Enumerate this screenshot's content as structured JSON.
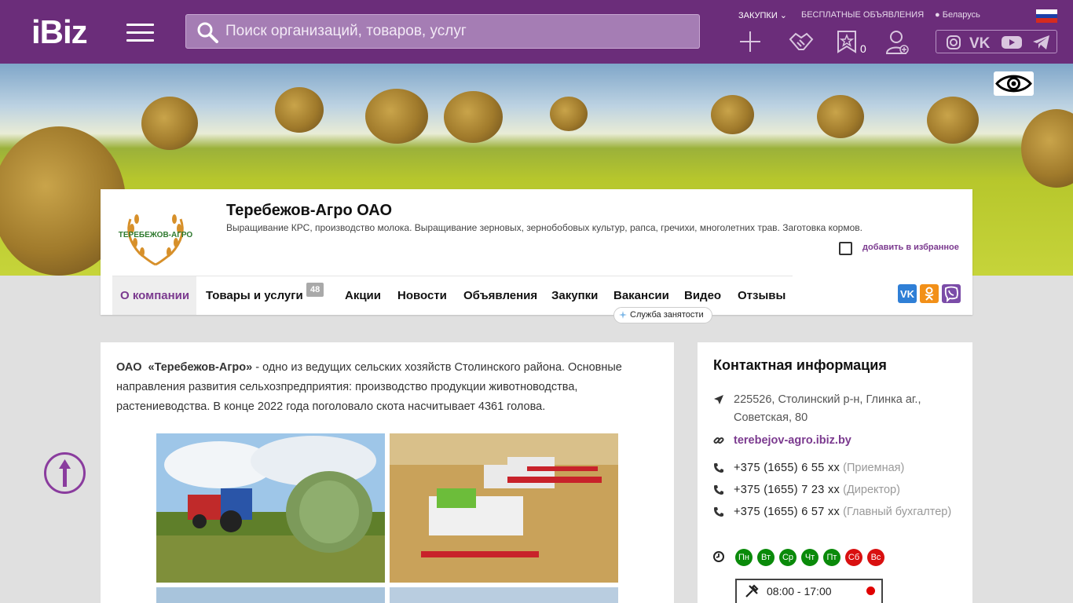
{
  "header": {
    "logo": "iBiz",
    "search_placeholder": "Поиск организаций, товаров, услуг",
    "links": [
      "ЗАКУПКИ",
      "БЕСПЛАТНЫЕ ОБЪЯВЛЕНИЯ",
      "Беларусь"
    ],
    "favorites_count": "0",
    "social": [
      "instagram-icon",
      "vk-icon",
      "youtube-icon",
      "telegram-icon"
    ]
  },
  "company": {
    "logo_text": "ТЕРЕБЕЖОВ-АГРО",
    "title": "Теребежов-Агро ОАО",
    "description": "Выращивание КРС, производство молока. Выращивание зерновых, зернобобовых культур, рапса, гречихи, многолетних трав. Заготовка кормов.",
    "favorite_label": "добавить в избранное"
  },
  "nav": {
    "tabs": [
      {
        "label": "О компании",
        "active": true
      },
      {
        "label": "Товары и услуги",
        "badge": "48"
      },
      {
        "label": "Акции"
      },
      {
        "label": "Новости"
      },
      {
        "label": "Объявления"
      },
      {
        "label": "Закупки"
      },
      {
        "label": "Вакансии"
      },
      {
        "label": "Видео"
      },
      {
        "label": "Отзывы"
      }
    ],
    "service_pill": "Служба занятости",
    "share": [
      "vk-share-icon",
      "ok-share-icon",
      "viber-share-icon"
    ]
  },
  "about": {
    "prefix": "ОАО",
    "name": "«Теребежов-Агро»",
    "text": " - одно из ведущих сельских хозяйств Столинского района. Основные направления развития сельхозпредприятия: производство продукции животноводства, растениеводства. В конце 2022 года поголовало скота насчитывает 4361 голова."
  },
  "contacts": {
    "title": "Контактная информация",
    "address": "225526, Столинский р-н, Глинка аг., Советская, 80",
    "site": "terebejov-agro.ibiz.by",
    "phones": [
      {
        "number": "+375 (1655) 6 55 xx",
        "note": "(Приемная)"
      },
      {
        "number": "+375 (1655) 7 23 xx",
        "note": "(Директор)"
      },
      {
        "number": "+375 (1655) 6 57 xx",
        "note": "(Главный бухгалтер)"
      }
    ],
    "days": [
      {
        "label": "Пн",
        "color": "#0a8a0a"
      },
      {
        "label": "Вт",
        "color": "#0a8a0a"
      },
      {
        "label": "Ср",
        "color": "#0a8a0a"
      },
      {
        "label": "Чт",
        "color": "#0a8a0a"
      },
      {
        "label": "Пт",
        "color": "#0a8a0a"
      },
      {
        "label": "Сб",
        "color": "#d91010"
      },
      {
        "label": "Вс",
        "color": "#d91010"
      }
    ],
    "hours": "08:00 - 17:00"
  },
  "colors": {
    "brand": "#6b2d7a",
    "accent": "#7b3a8f"
  }
}
